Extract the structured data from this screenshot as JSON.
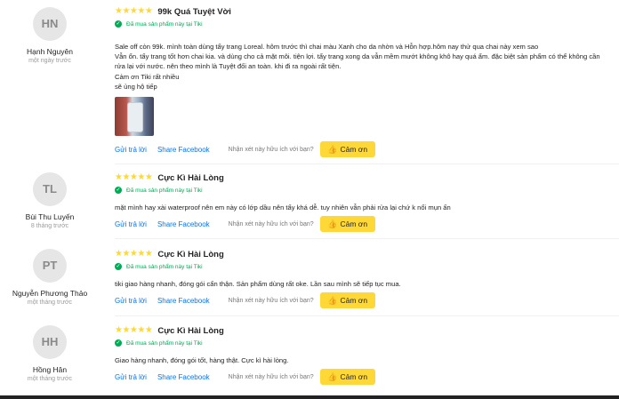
{
  "reviews": [
    {
      "initials": "HN",
      "name": "Hạnh Nguyên",
      "time": "một ngày trước",
      "stars": "★★★★★",
      "title": "99k Quá Tuyệt Vời",
      "bought": "Đã mua sản phẩm này tại Tiki",
      "content": [
        "Sale off còn 99k. mình toàn dùng tẩy trang Loreal. hôm trước thì chai màu Xanh cho da nhờn và Hỗn hợp.hôm nay thử qua chai này xem sao",
        "Vẫn ổn. tẩy trang tốt hơn chai kia. và dùng cho cả mặt môi. tiện lợi. tẩy trang xong da vẫn mềm mướt không khô hay quá ẩm. đặc biệt sản phẩm có thể không cần",
        "rửa lại với nước. nên theo mình là Tuyệt đối an toàn. khi đi ra ngoài rất tiện.",
        "Cảm ơn Tiki rất nhiều",
        "sẽ ủng hộ tiếp"
      ],
      "reply": "Gửi trả lời",
      "share": "Share Facebook",
      "helpful": "Nhận xét này hữu ích với bạn?",
      "thanks": "Cảm ơn"
    },
    {
      "initials": "TL",
      "name": "Bùi Thu Luyến",
      "time": "8 tháng trước",
      "stars": "★★★★★",
      "title": "Cực Kì Hài Lòng",
      "bought": "Đã mua sản phẩm này tại Tiki",
      "content": [
        "mặt mình hay xài waterproof nên em này có lớp dầu nên tẩy khá dễ. tuy nhiên vẫn phải rửa lại chứ k nổi mụn ấn"
      ],
      "reply": "Gửi trả lời",
      "share": "Share Facebook",
      "helpful": "Nhận xét này hữu ích với bạn?",
      "thanks": "Cảm ơn"
    },
    {
      "initials": "PT",
      "name": "Nguyễn Phương Thảo",
      "time": "một tháng trước",
      "stars": "★★★★★",
      "title": "Cực Kì Hài Lòng",
      "bought": "Đã mua sản phẩm này tại Tiki",
      "content": [
        "tiki giao hàng nhanh, đóng gói cẩn thận. Sản phẩm dùng rất oke. Lần sau mình sẽ tiếp tục mua."
      ],
      "reply": "Gửi trả lời",
      "share": "Share Facebook",
      "helpful": "Nhận xét này hữu ích với bạn?",
      "thanks": "Cảm ơn"
    },
    {
      "initials": "HH",
      "name": "Hồng Hân",
      "time": "một tháng trước",
      "stars": "★★★★★",
      "title": "Cực Kì Hài Lòng",
      "bought": "Đã mua sản phẩm này tại Tiki",
      "content": [
        "Giao hàng nhanh, đóng gói tốt, hàng thật. Cực kì hài lòng."
      ],
      "reply": "Gửi trả lời",
      "share": "Share Facebook",
      "helpful": "Nhận xét này hữu ích với bạn?",
      "thanks": "Cảm ơn"
    }
  ],
  "icons": {
    "star": "star-icon",
    "check": "verified-check-icon",
    "thumb": "thumb-up-icon"
  },
  "colors": {
    "star": "#fdd836",
    "verified": "#00ab56",
    "link": "#0b74e5",
    "button": "#fdd836"
  }
}
